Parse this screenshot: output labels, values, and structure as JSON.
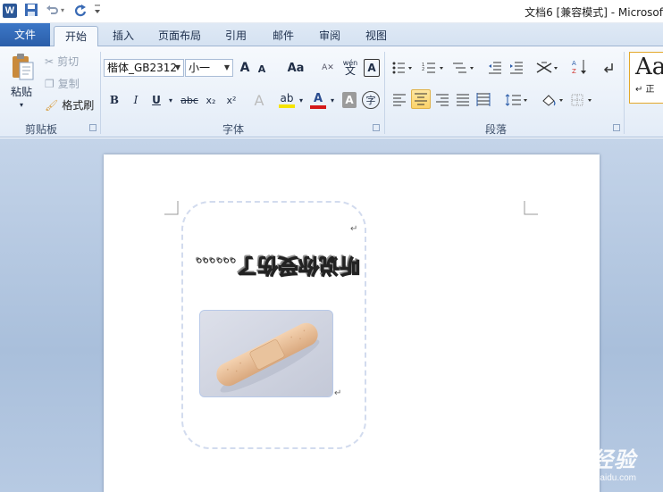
{
  "titlebar": {
    "app_icon": "W",
    "title": "文档6 [兼容模式]  -  Microsof"
  },
  "tabs": [
    {
      "label": "文件"
    },
    {
      "label": "开始"
    },
    {
      "label": "插入"
    },
    {
      "label": "页面布局"
    },
    {
      "label": "引用"
    },
    {
      "label": "邮件"
    },
    {
      "label": "审阅"
    },
    {
      "label": "视图"
    }
  ],
  "clipboard": {
    "paste_label": "粘贴",
    "cut_label": "剪切",
    "copy_label": "复制",
    "format_painter_label": "格式刷",
    "group_label": "剪贴板"
  },
  "font": {
    "font_name": "楷体_GB2312",
    "font_size": "小一",
    "group_label": "字体",
    "bold": "B",
    "italic": "I",
    "underline": "U",
    "strike": "abc",
    "subscript": "x₂",
    "superscript": "x²",
    "case_label": "Aa",
    "grow": "A",
    "shrink": "A",
    "wen": "wén",
    "wen_sub": "文",
    "charborder": "A",
    "highlight_color": "#f5e400",
    "font_color_value": "#d41919",
    "shade_glyph": "A",
    "circle_glyph": "字",
    "phonetic_glyph": "A"
  },
  "paragraph": {
    "group_label": "段落"
  },
  "styles": {
    "preview": "Aa",
    "sub": "↵ 正"
  },
  "document": {
    "flipped_text": "听说你受伤了……",
    "return_mark": "↵"
  },
  "watermark": {
    "brand": "Baidu 经验",
    "url": "jingyan.baidu.com"
  }
}
